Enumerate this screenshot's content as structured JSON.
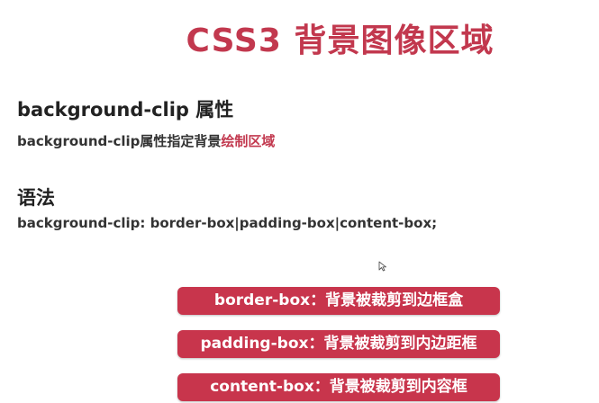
{
  "slide": {
    "title": "CSS3 背景图像区域",
    "heading": "background-clip 属性",
    "description_prefix": "background-clip属性指定背景",
    "description_highlight": "绘制区域",
    "syntax_heading": "语法",
    "syntax": "background-clip: border-box|padding-box|content-box;",
    "options": [
      "border-box：背景被裁剪到边框盒",
      "padding-box：背景被裁剪到内边距框",
      "content-box：背景被裁剪到内容框"
    ]
  },
  "colors": {
    "accent": "#c2384e",
    "pill": "#c8354c",
    "text": "#222222"
  },
  "icons": {
    "cursor": "mouse-pointer-icon"
  }
}
